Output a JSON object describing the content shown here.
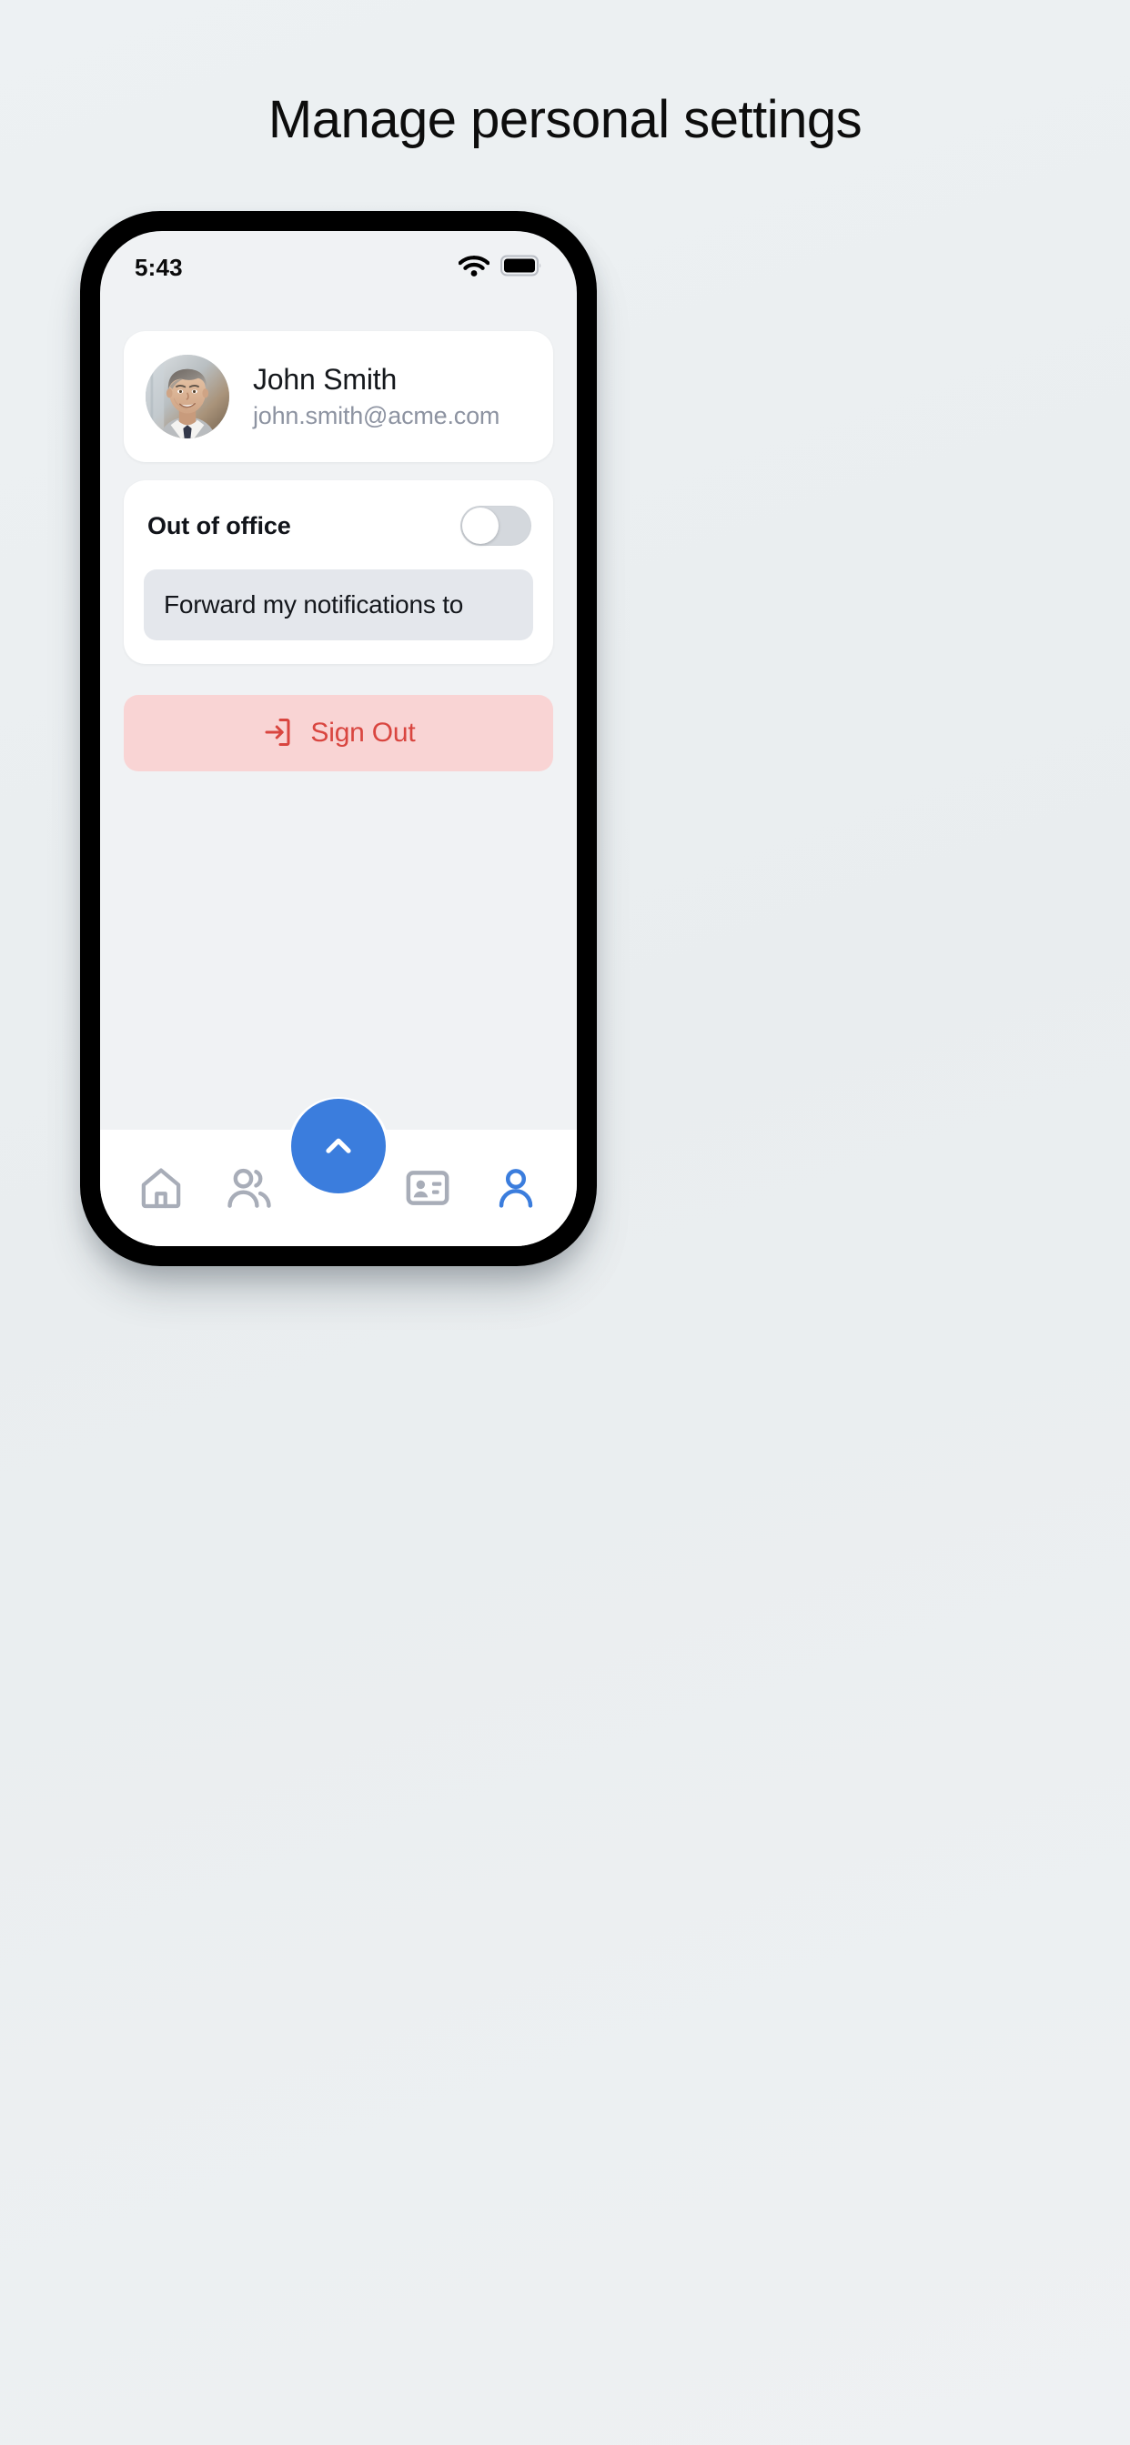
{
  "page": {
    "title": "Manage personal settings"
  },
  "colors": {
    "accent_blue": "#3b7ddd",
    "danger_red": "#d9453f",
    "danger_bg": "#f9d4d4",
    "inactive_grey": "#a8adb8",
    "screen_bg": "#f0f2f4",
    "card_bg": "#ffffff",
    "field_bg": "#e4e7ec",
    "toggle_track": "#d4d8dd",
    "page_bg": "#eceff1"
  },
  "status_bar": {
    "time": "5:43",
    "wifi_icon": "wifi-icon",
    "battery_icon": "battery-full-icon"
  },
  "profile": {
    "avatar_icon": "avatar-photo",
    "name": "John Smith",
    "email": "john.smith@acme.com"
  },
  "out_of_office": {
    "label": "Out of office",
    "toggle_state": "off",
    "forward_field": {
      "value": "Forward my notifications to",
      "placeholder": "Forward my notifications to"
    }
  },
  "sign_out": {
    "label": "Sign Out",
    "icon": "sign-out-icon"
  },
  "bottom_nav": {
    "items": [
      {
        "icon": "home-icon",
        "name": "home",
        "active": false
      },
      {
        "icon": "people-icon",
        "name": "contacts",
        "active": false
      },
      {
        "icon": "id-card-icon",
        "name": "directory",
        "active": false
      },
      {
        "icon": "person-icon",
        "name": "profile",
        "active": true
      }
    ],
    "fab": {
      "icon": "chevron-up-icon",
      "name": "expand-button"
    }
  }
}
